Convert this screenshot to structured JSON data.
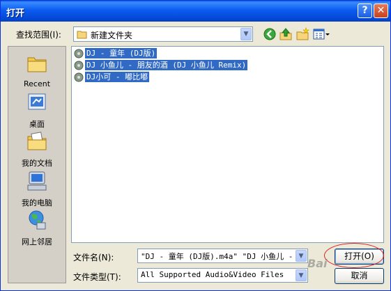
{
  "window": {
    "title": "打开",
    "help_glyph": "?",
    "close_glyph": "✕"
  },
  "lookin": {
    "label": "查找范围(I):",
    "value": "新建文件夹"
  },
  "toolbar": {
    "icons": [
      "back-icon",
      "up-folder-icon",
      "new-folder-icon",
      "view-menu-icon"
    ]
  },
  "places": [
    {
      "label": "Recent",
      "icon": "recent-folder-icon"
    },
    {
      "label": "桌面",
      "icon": "desktop-icon"
    },
    {
      "label": "我的文档",
      "icon": "my-documents-icon"
    },
    {
      "label": "我的电脑",
      "icon": "my-computer-icon"
    },
    {
      "label": "网上邻居",
      "icon": "network-places-icon"
    }
  ],
  "files": [
    {
      "name": "DJ - 童年 (DJ版)",
      "selected": true
    },
    {
      "name": "DJ 小鱼儿 - 朋友的酒 (DJ 小鱼儿 Remix)",
      "selected": true
    },
    {
      "name": "DJ小可 - 嘟比嘟",
      "selected": true
    }
  ],
  "filename": {
    "label": "文件名(N):",
    "value": "\"DJ - 童年 (DJ版).m4a\" \"DJ 小鱼儿 - 朋"
  },
  "filetype": {
    "label": "文件类型(T):",
    "value": "All Supported Audio&Video Files"
  },
  "buttons": {
    "open": "打开(O)",
    "cancel": "取消"
  },
  "watermark": "Bai",
  "colors": {
    "selection": "#316ac5",
    "titlebar": "#0b5cf0",
    "annotation_circle": "#e02020"
  }
}
